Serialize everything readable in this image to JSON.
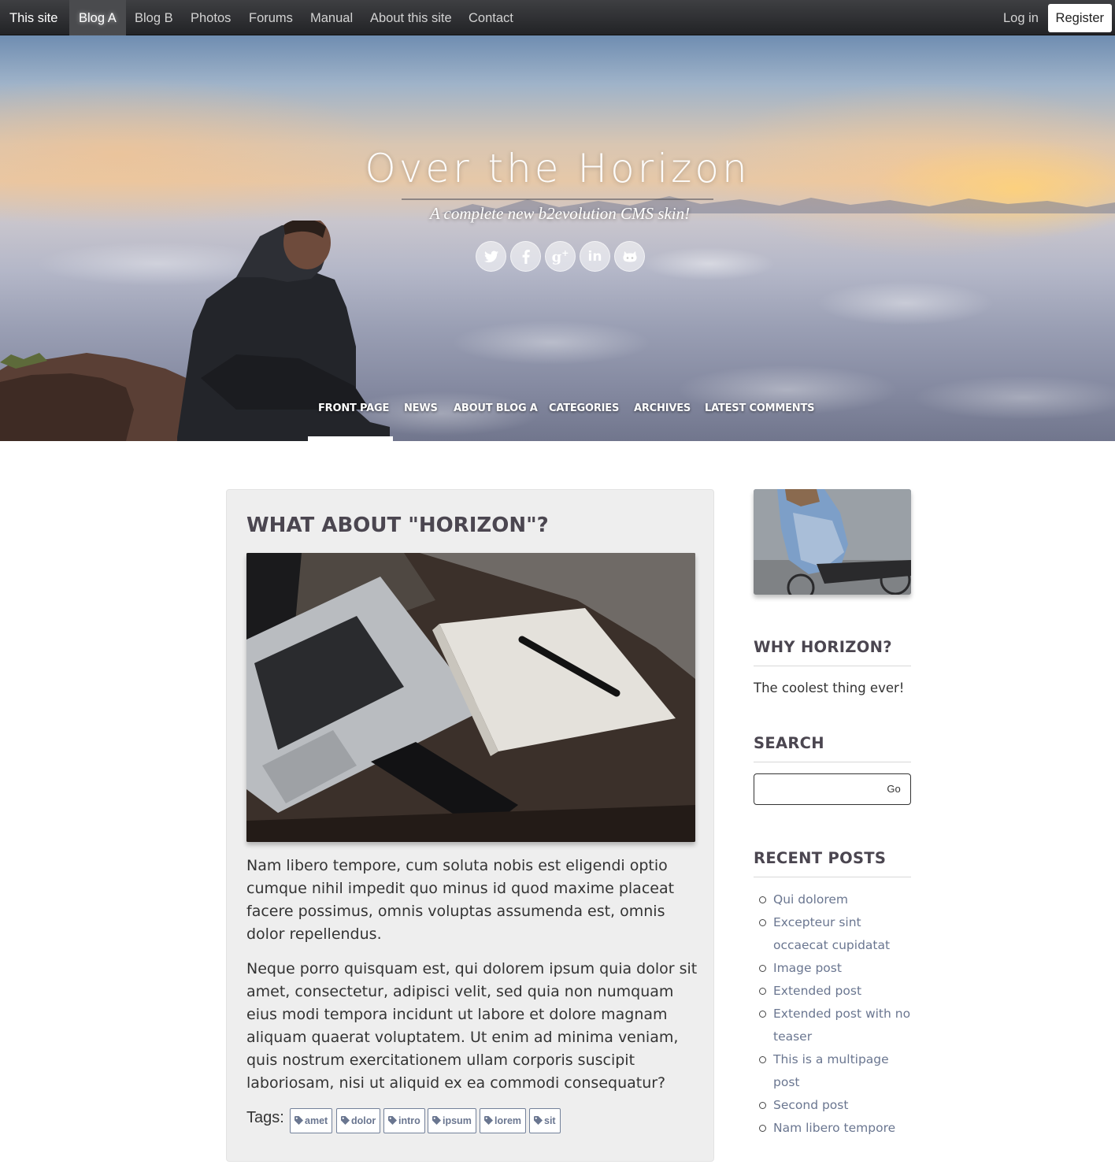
{
  "topnav": {
    "site_label": "This site",
    "items": [
      "Blog A",
      "Blog B",
      "Photos",
      "Forums",
      "Manual",
      "About this site",
      "Contact"
    ],
    "active": "Blog A",
    "login_label": "Log in",
    "register_label": "Register"
  },
  "hero": {
    "title": "Over the Horizon",
    "subtitle": "A complete new b2evolution CMS skin!",
    "social_icons": [
      "twitter-icon",
      "facebook-icon",
      "google-plus-icon",
      "linkedin-icon",
      "github-icon"
    ],
    "menu": [
      "FRONT PAGE",
      "NEWS",
      "ABOUT BLOG A",
      "CATEGORIES",
      "ARCHIVES",
      "LATEST COMMENTS"
    ],
    "active_menu": "FRONT PAGE"
  },
  "post": {
    "title": "WHAT ABOUT \"HORIZON\"?",
    "paragraphs": [
      "Nam libero tempore, cum soluta nobis est eligendi optio cumque nihil impedit quo minus id quod maxime placeat facere possimus, omnis voluptas assumenda est, omnis dolor repellendus.",
      " Neque porro quisquam est, qui dolorem ipsum quia dolor sit amet, consectetur, adipisci velit, sed quia non numquam eius modi tempora incidunt ut labore et dolore magnam aliquam quaerat voluptatem. Ut enim ad minima veniam, quis nostrum exercitationem ullam corporis suscipit laboriosam, nisi ut aliquid ex ea commodi consequatur?"
    ],
    "tags_label": "Tags:",
    "tags": [
      "amet",
      "dolor",
      "intro",
      "ipsum",
      "lorem",
      "sit"
    ]
  },
  "sidebar": {
    "why_title": "WHY HORIZON?",
    "why_text": "The coolest thing ever!",
    "search_title": "SEARCH",
    "search_value": "",
    "search_button": "Go",
    "recent_title": "RECENT POSTS",
    "recent_posts": [
      "Qui dolorem",
      "Excepteur sint occaecat cupidatat",
      "Image post",
      "Extended post",
      "Extended post with no teaser",
      "This is a multipage post",
      "Second post",
      "Nam libero tempore"
    ]
  },
  "colors": {
    "navbar": "#2c2d30",
    "post_bg": "#eeeeee",
    "heading": "#4b4650",
    "link": "#6a7690"
  }
}
